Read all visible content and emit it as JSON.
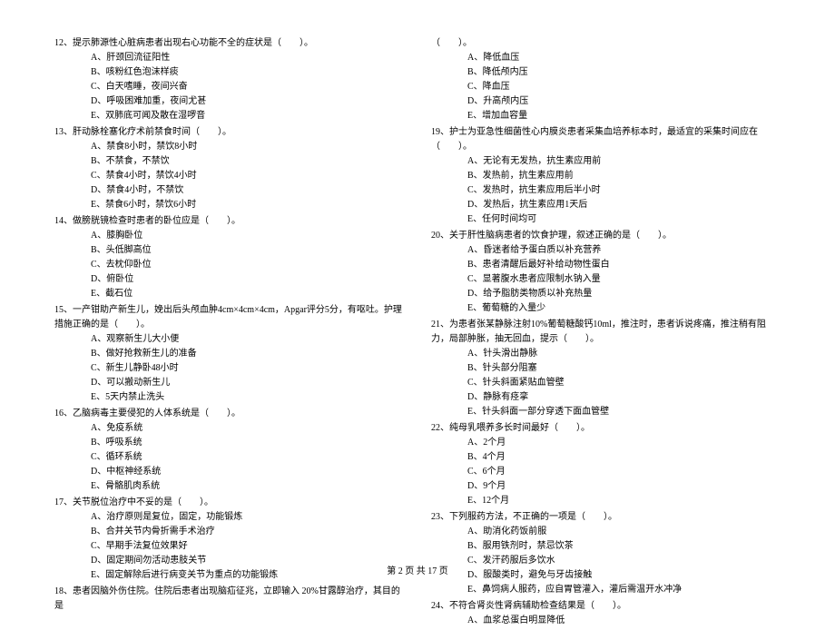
{
  "left": {
    "q12": {
      "text": "12、提示肺源性心脏病患者出现右心功能不全的症状是（　　）。",
      "A": "A、肝颈回流征阳性",
      "B": "B、咳粉红色泡沫样痰",
      "C": "C、白天嗜睡，夜间兴奋",
      "D": "D、呼吸困难加重，夜间尤甚",
      "E": "E、双肺底可闻及散在湿啰音"
    },
    "q13": {
      "text": "13、肝动脉栓塞化疗术前禁食时间（　　）。",
      "A": "A、禁食8小时，禁饮8小时",
      "B": "B、不禁食，不禁饮",
      "C": "C、禁食4小时，禁饮4小时",
      "D": "D、禁食4小时，不禁饮",
      "E": "E、禁食6小时，禁饮6小时"
    },
    "q14": {
      "text": "14、做膀胱镜检查时患者的卧位应是（　　）。",
      "A": "A、膝胸卧位",
      "B": "B、头低脚高位",
      "C": "C、去枕仰卧位",
      "D": "D、俯卧位",
      "E": "E、截石位"
    },
    "q15": {
      "text": "15、一产钳助产新生儿，娩出后头颅血肿4cm×4cm×4cm，Apgar评分5分，有呕吐。护理措施正确的是（　　）。",
      "A": "A、观察新生儿大小便",
      "B": "B、做好抢救新生儿的准备",
      "C": "C、新生儿静卧48小时",
      "D": "D、可以搬动新生儿",
      "E": "E、5天内禁止洗头"
    },
    "q16": {
      "text": "16、乙脑病毒主要侵犯的人体系统是（　　）。",
      "A": "A、免疫系统",
      "B": "B、呼吸系统",
      "C": "C、循环系统",
      "D": "D、中枢神经系统",
      "E": "E、骨骼肌肉系统"
    },
    "q17": {
      "text": "17、关节脱位治疗中不妥的是（　　）。",
      "A": "A、治疗原则是复位，固定，功能锻炼",
      "B": "B、合并关节内骨折需手术治疗",
      "C": "C、早期手法复位效果好",
      "D": "D、固定期间勿活动患肢关节",
      "E": "E、固定解除后进行病变关节为重点的功能锻炼"
    },
    "q18": {
      "text": "18、患者因脑外伤住院。住院后患者出现脑疝征兆，立即输入 20%甘露醇治疗，其目的是"
    }
  },
  "right": {
    "q18cont": {
      "text": "（　　）。",
      "A": "A、降低血压",
      "B": "B、降低颅内压",
      "C": "C、降血压",
      "D": "D、升高颅内压",
      "E": "E、增加血容量"
    },
    "q19": {
      "text": "19、护士为亚急性细菌性心内膜炎患者采集血培养标本时，最适宜的采集时间应在（　　）。",
      "A": "A、无论有无发热，抗生素应用前",
      "B": "B、发热前，抗生素应用前",
      "C": "C、发热时，抗生素应用后半小时",
      "D": "D、发热后，抗生素应用1天后",
      "E": "E、任何时间均可"
    },
    "q20": {
      "text": "20、关于肝性脑病患者的饮食护理，叙述正确的是（　　）。",
      "A": "A、昏迷者给予蛋白质以补充营养",
      "B": "B、患者清醒后最好补给动物性蛋白",
      "C": "C、显著腹水患者应限制水钠入量",
      "D": "D、给予脂肪类物质以补充热量",
      "E": "E、葡萄糖的入量少"
    },
    "q21": {
      "text": "21、为患者张某静脉注射10%葡萄糖酸钙10ml，推注时，患者诉说疼痛，推注稍有阻力，局部肿胀，抽无回血，提示（　　）。",
      "A": "A、针头滑出静脉",
      "B": "B、针头部分阻塞",
      "C": "C、针头斜面紧贴血管壁",
      "D": "D、静脉有痉挛",
      "E": "E、针头斜面一部分穿透下面血管壁"
    },
    "q22": {
      "text": "22、纯母乳喂养多长时间最好（　　）。",
      "A": "A、2个月",
      "B": "B、4个月",
      "C": "C、6个月",
      "D": "D、9个月",
      "E": "E、12个月"
    },
    "q23": {
      "text": "23、下列服药方法，不正确的一项是（　　）。",
      "A": "A、助消化药饭前服",
      "B": "B、服用铁剂时，禁忌饮茶",
      "C": "C、发汗药服后多饮水",
      "D": "D、服酸类时，避免与牙齿接触",
      "E": "E、鼻饲病人服药，应自胃管灌入，灌后需温开水冲净"
    },
    "q24": {
      "text": "24、不符合肾炎性肾病辅助检查结果是（　　）。",
      "A": "A、血浆总蛋白明显降低"
    }
  },
  "footer": "第 2 页 共 17 页"
}
